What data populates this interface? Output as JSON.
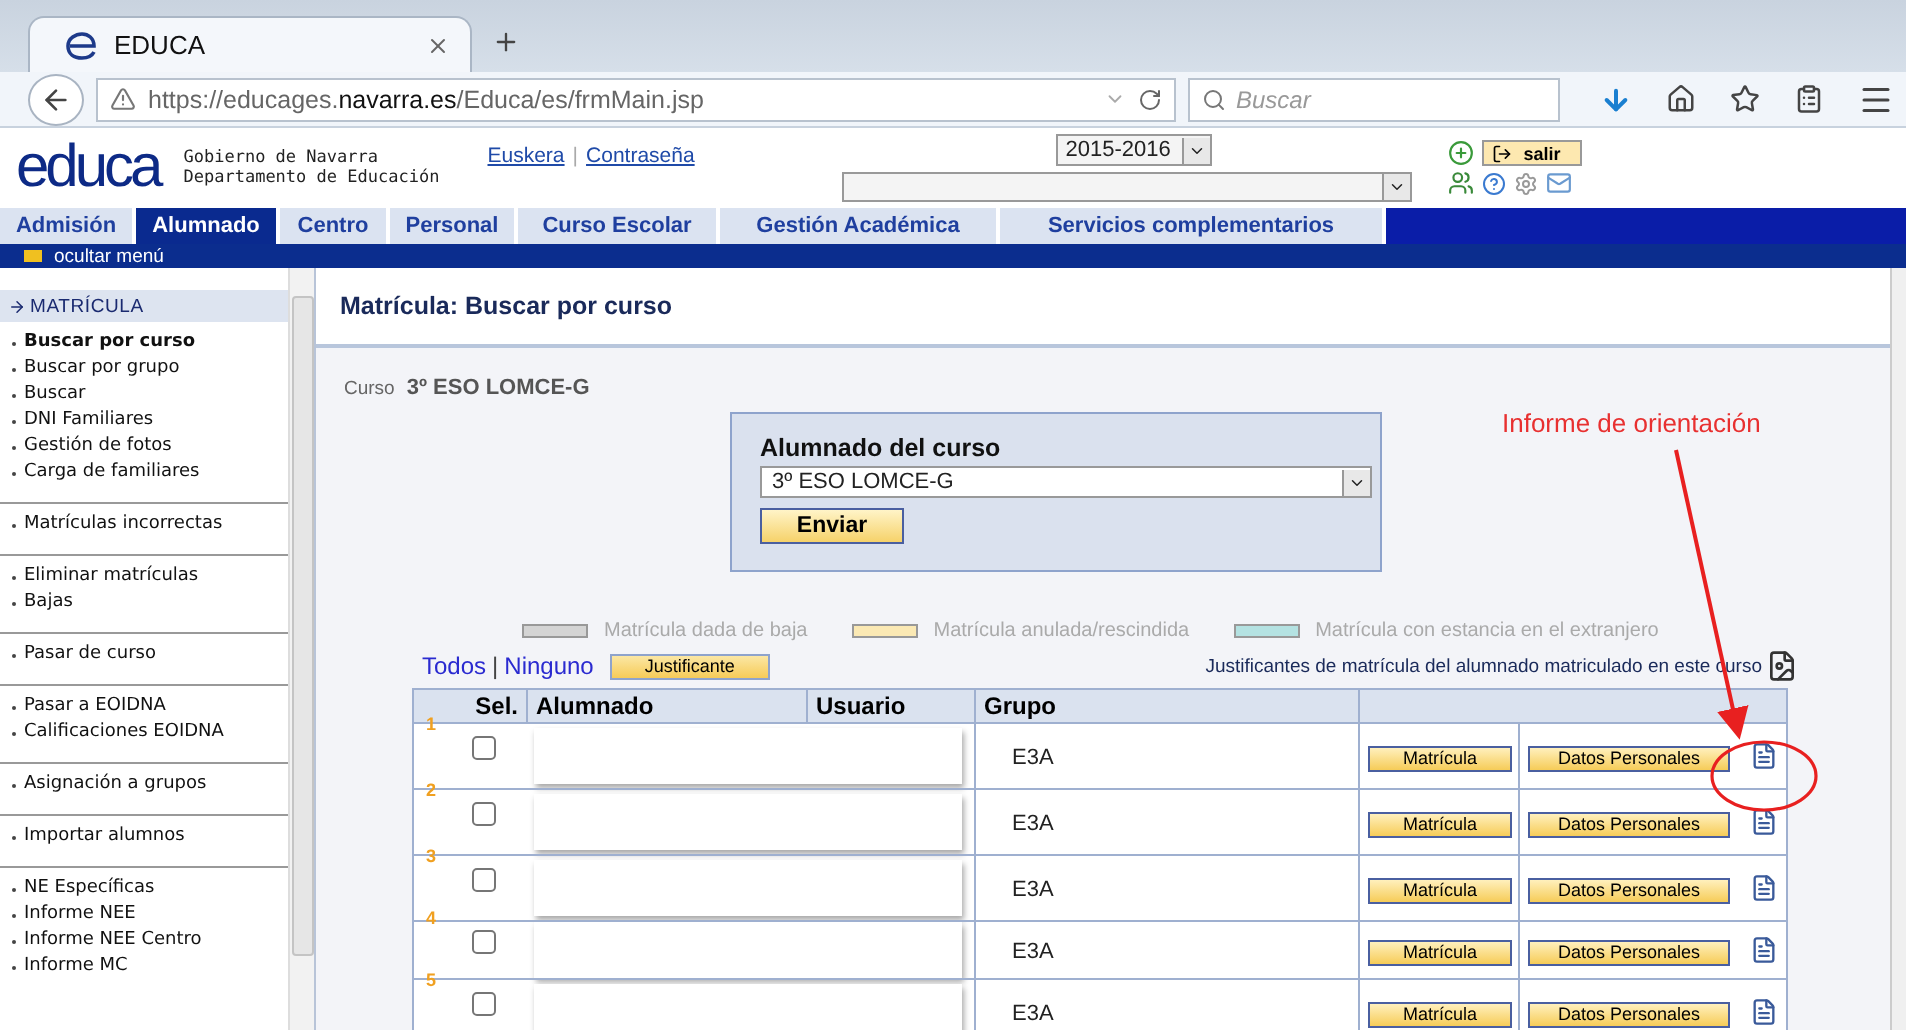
{
  "browser": {
    "tab_title": "EDUCA",
    "url_prefix": "https://educages.",
    "url_domain": "navarra.es",
    "url_path": "/Educa/es/frmMain.jsp",
    "search_placeholder": "Buscar"
  },
  "header": {
    "logo": "educa",
    "org_lines": [
      "Gobierno de Navarra",
      "Departamento de Educación"
    ],
    "links": [
      "Euskera",
      "Contraseña"
    ],
    "link_separator": "|",
    "year": "2015-2016",
    "logout": "salir"
  },
  "menu": [
    {
      "label": "Admisión",
      "selected": false
    },
    {
      "label": "Alumnado",
      "selected": true
    },
    {
      "label": "Centro",
      "selected": false
    },
    {
      "label": "Personal",
      "selected": false
    },
    {
      "label": "Curso Escolar",
      "selected": false
    },
    {
      "label": "Gestión Académica",
      "selected": false
    },
    {
      "label": "Servicios complementarios",
      "selected": false
    }
  ],
  "hide_menu": "ocultar menú",
  "sidebar": {
    "section": "MATRÍCULA",
    "groups": [
      [
        {
          "label": "Buscar por curso",
          "selected": true
        },
        {
          "label": "Buscar por grupo",
          "selected": false
        },
        {
          "label": "Buscar",
          "selected": false
        },
        {
          "label": "DNI Familiares",
          "selected": false
        },
        {
          "label": "Gestión de fotos",
          "selected": false
        },
        {
          "label": "Carga de familiares",
          "selected": false
        }
      ],
      [
        {
          "label": "Matrículas incorrectas",
          "selected": false
        }
      ],
      [
        {
          "label": "Eliminar matrículas",
          "selected": false
        },
        {
          "label": "Bajas",
          "selected": false
        }
      ],
      [
        {
          "label": "Pasar de curso",
          "selected": false
        }
      ],
      [
        {
          "label": "Pasar a EOIDNA",
          "selected": false
        },
        {
          "label": "Calificaciones EOIDNA",
          "selected": false
        }
      ],
      [
        {
          "label": "Asignación a grupos",
          "selected": false
        }
      ],
      [
        {
          "label": "Importar alumnos",
          "selected": false
        }
      ],
      [
        {
          "label": "NE Específicas",
          "selected": false
        },
        {
          "label": "Informe NEE",
          "selected": false
        },
        {
          "label": "Informe NEE Centro",
          "selected": false
        },
        {
          "label": "Informe MC",
          "selected": false
        }
      ]
    ]
  },
  "main": {
    "title": "Matrícula: Buscar por curso",
    "course_label": "Curso",
    "course_value": "3º ESO LOMCE-G",
    "form": {
      "title": "Alumnado del curso",
      "select_value": "3º ESO LOMCE-G",
      "submit": "Enviar"
    },
    "legend": [
      {
        "label": "Matrícula dada de baja",
        "color": "#d4d4d4"
      },
      {
        "label": "Matrícula anulada/rescindida",
        "color": "#fbe9b4"
      },
      {
        "label": "Matrícula con estancia en el extranjero",
        "color": "#b4e2e2"
      }
    ],
    "select_links": [
      "Todos",
      "Ninguno"
    ],
    "select_separator": "|",
    "justify_button": "Justificante",
    "receipts_caption": "Justificantes de matrícula del alumnado matriculado en este curso",
    "columns": [
      "Sel.",
      "Alumnado",
      "Usuario",
      "Grupo"
    ],
    "rows": [
      {
        "number": "1",
        "checked": false,
        "group": "E3A",
        "buttons": [
          "Matrícula",
          "Datos Personales"
        ]
      },
      {
        "number": "2",
        "checked": false,
        "group": "E3A",
        "buttons": [
          "Matrícula",
          "Datos Personales"
        ]
      },
      {
        "number": "3",
        "checked": false,
        "group": "E3A",
        "buttons": [
          "Matrícula",
          "Datos Personales"
        ]
      },
      {
        "number": "4",
        "checked": false,
        "group": "E3A",
        "buttons": [
          "Matrícula",
          "Datos Personales"
        ]
      },
      {
        "number": "5",
        "checked": false,
        "group": "E3A",
        "buttons": [
          "Matrícula",
          "Datos Personales"
        ]
      }
    ]
  },
  "annotation": "Informe de orientación"
}
